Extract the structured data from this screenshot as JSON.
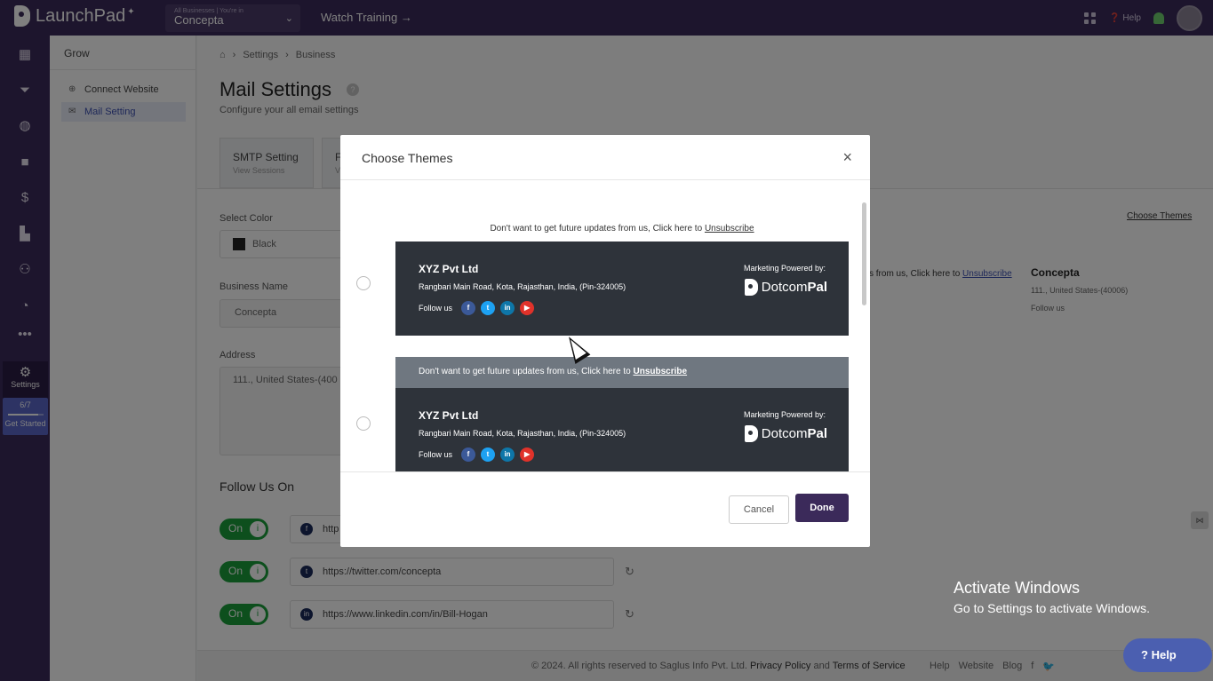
{
  "topbar": {
    "app_name": "LaunchPad",
    "business_caption": "All Businesses | You're in",
    "business_name": "Concepta",
    "watch_training": "Watch Training →",
    "help": "Help"
  },
  "rail": {
    "settings_label": "Settings",
    "progress_text": "6/7",
    "get_started": "Get Started",
    "progress_fraction": 0.857
  },
  "subbar": {
    "title": "Grow",
    "items": [
      {
        "label": "Connect Website",
        "icon": "link-icon"
      },
      {
        "label": "Mail Setting",
        "icon": "mail-icon"
      }
    ]
  },
  "main": {
    "breadcrumb": [
      "Settings",
      "Business"
    ],
    "title": "Mail Settings",
    "subtitle": "Configure your all email settings",
    "tabs": [
      {
        "label": "SMTP Setting",
        "sub": "View Sessions"
      },
      {
        "label": "F",
        "sub": "V"
      }
    ],
    "select_color_label": "Select Color",
    "color_value": "Black",
    "business_name_label": "Business Name",
    "business_name_value": "Concepta",
    "address_label": "Address",
    "address_value": "111., United States-(400",
    "follow_title": "Follow Us On",
    "social": [
      {
        "state": "On",
        "url": "http",
        "icon": "facebook-icon"
      },
      {
        "state": "On",
        "url": "https://twitter.com/concepta",
        "icon": "twitter-icon"
      },
      {
        "state": "On",
        "url": "https://www.linkedin.com/in/Bill-Hogan",
        "icon": "linkedin-icon"
      }
    ],
    "choose_themes_link": "Choose Themes",
    "preview_unsub": "s from us, Click here to",
    "preview_unsub_link": "Unsubscribe",
    "preview_company": "Concepta",
    "preview_address": "111., United States-(40006)",
    "preview_follow": "Follow us"
  },
  "footer": {
    "copyright": "© 2024. All rights reserved to Saglus Info Pvt. Ltd.",
    "privacy": "Privacy Policy",
    "and": "and",
    "terms": "Terms of Service",
    "links": [
      "Help",
      "Website",
      "Blog"
    ]
  },
  "help_button": "Help",
  "watermark": {
    "line1": "Activate Windows",
    "line2": "Go to Settings to activate Windows."
  },
  "modal": {
    "title": "Choose Themes",
    "unsub_text": "Don't want to get future updates from us, Click here to",
    "unsub_link": "Unsubscribe",
    "company": "XYZ Pvt Ltd",
    "address": "Rangbari Main Road, Kota, Rajasthan, India, (Pin-324005)",
    "follow_us": "Follow us",
    "powered_by": "Marketing Powered by:",
    "brand_a": "Dotcom",
    "brand_b": "Pal",
    "cancel": "Cancel",
    "done": "Done"
  },
  "colors": {
    "brand_dark": "#3b2a5a",
    "theme_dark": "#2e333a",
    "toggle_green": "#1b9e3a"
  }
}
